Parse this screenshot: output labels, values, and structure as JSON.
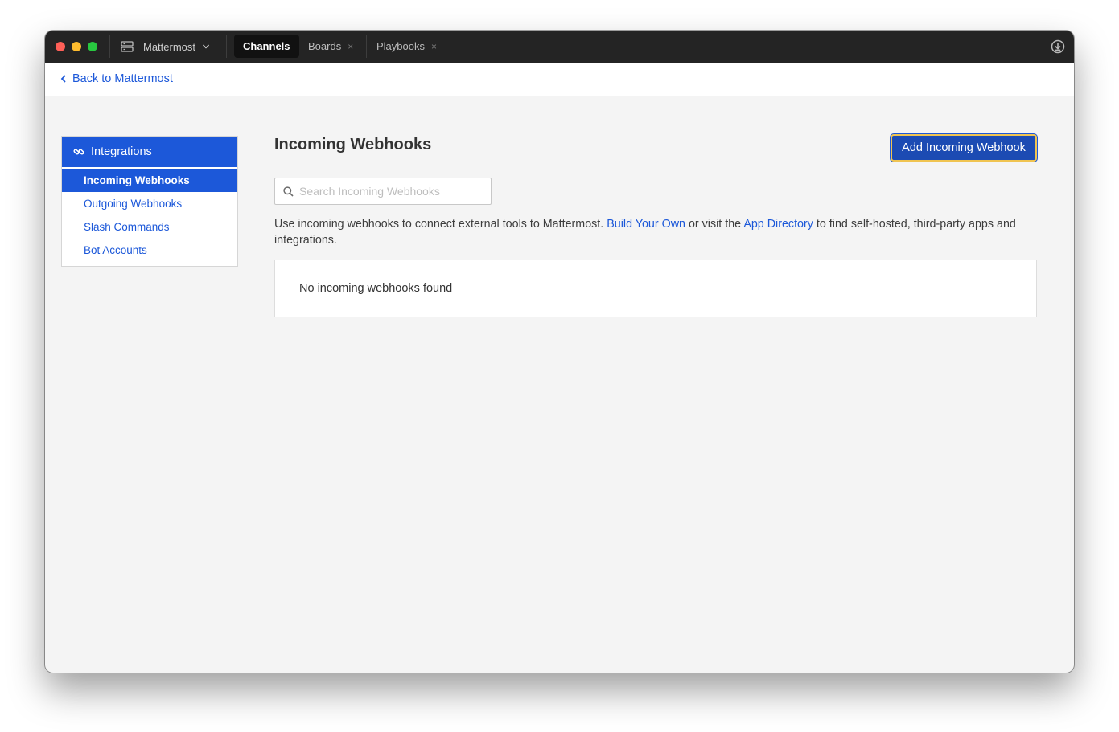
{
  "titlebar": {
    "server_name": "Mattermost",
    "tabs": [
      {
        "label": "Channels",
        "active": true,
        "closable": false
      },
      {
        "label": "Boards",
        "active": false,
        "closable": true
      },
      {
        "label": "Playbooks",
        "active": false,
        "closable": true
      }
    ],
    "close_glyph": "×"
  },
  "backbar": {
    "back_label": "Back to Mattermost"
  },
  "sidebar": {
    "header": "Integrations",
    "items": [
      {
        "label": "Incoming Webhooks",
        "active": true
      },
      {
        "label": "Outgoing Webhooks",
        "active": false
      },
      {
        "label": "Slash Commands",
        "active": false
      },
      {
        "label": "Bot Accounts",
        "active": false
      }
    ]
  },
  "main": {
    "title": "Incoming Webhooks",
    "add_button": "Add Incoming Webhook",
    "search_placeholder": "Search Incoming Webhooks",
    "search_value": "",
    "description": {
      "part1": "Use incoming webhooks to connect external tools to Mattermost. ",
      "link1": "Build Your Own",
      "part2": " or visit the ",
      "link2": "App Directory",
      "part3": " to find self-hosted, third-party apps and integrations."
    },
    "empty_message": "No incoming webhooks found"
  },
  "colors": {
    "accent": "#1c58d9",
    "titlebar": "#242424",
    "focus_ring": "#f0c451"
  },
  "icons": [
    "server-icon",
    "chevron-down-icon",
    "download-icon",
    "chevron-left-icon",
    "link-icon",
    "search-icon"
  ]
}
